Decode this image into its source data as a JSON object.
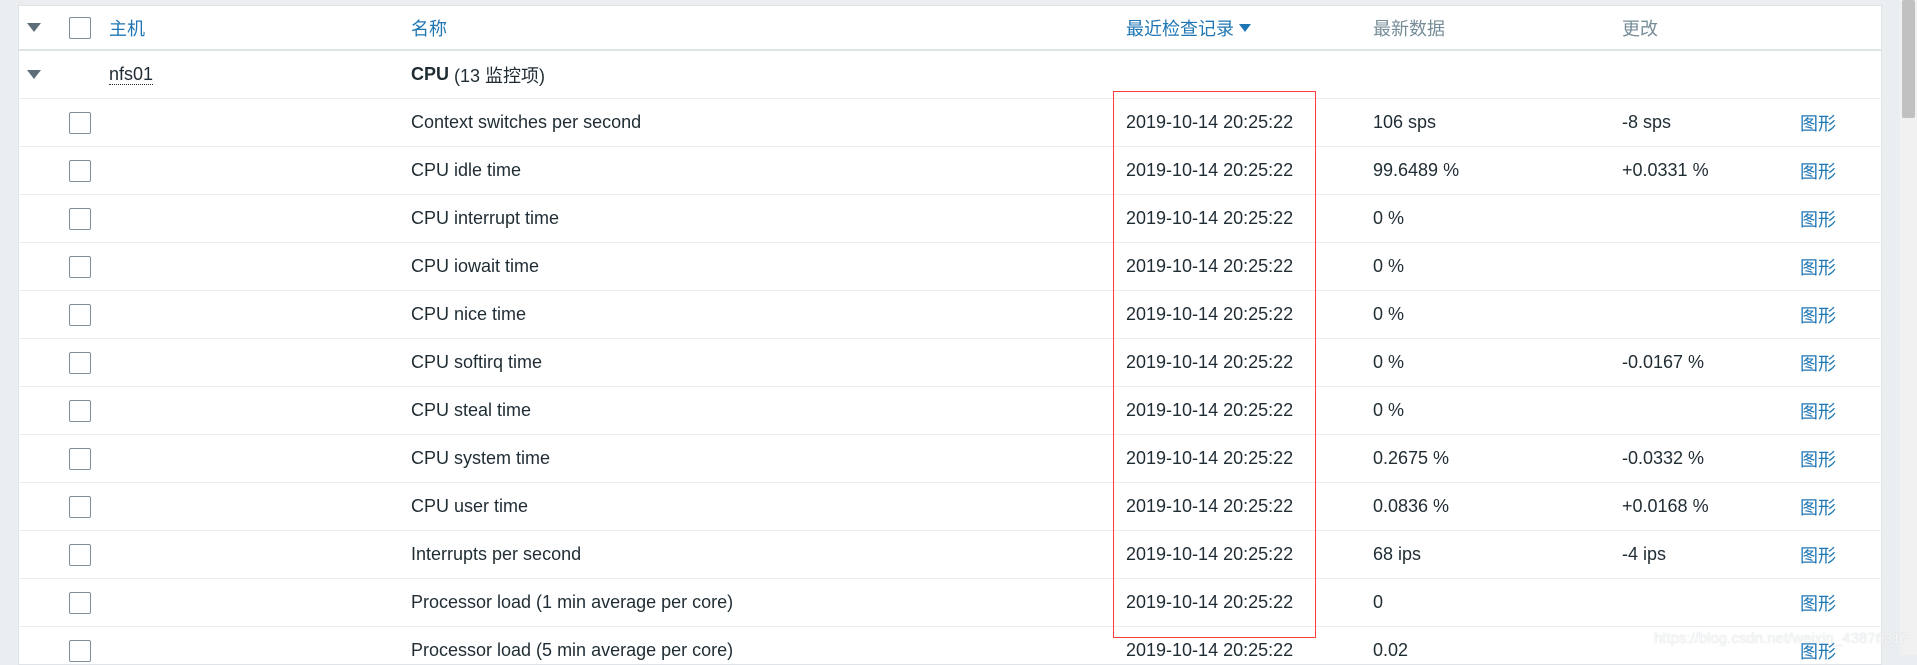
{
  "header": {
    "host_label": "主机",
    "name_label": "名称",
    "lastcheck_label": "最近检查记录",
    "lastvalue_label": "最新数据",
    "change_label": "更改"
  },
  "group": {
    "host": "nfs01",
    "name_bold": "CPU",
    "count_text": " (13 监控项)"
  },
  "items": [
    {
      "name": "Context switches per second",
      "lastcheck": "2019-10-14 20:25:22",
      "lastvalue": "106 sps",
      "change": "-8 sps",
      "action": "图形"
    },
    {
      "name": "CPU idle time",
      "lastcheck": "2019-10-14 20:25:22",
      "lastvalue": "99.6489 %",
      "change": "+0.0331 %",
      "action": "图形"
    },
    {
      "name": "CPU interrupt time",
      "lastcheck": "2019-10-14 20:25:22",
      "lastvalue": "0 %",
      "change": "",
      "action": "图形"
    },
    {
      "name": "CPU iowait time",
      "lastcheck": "2019-10-14 20:25:22",
      "lastvalue": "0 %",
      "change": "",
      "action": "图形"
    },
    {
      "name": "CPU nice time",
      "lastcheck": "2019-10-14 20:25:22",
      "lastvalue": "0 %",
      "change": "",
      "action": "图形"
    },
    {
      "name": "CPU softirq time",
      "lastcheck": "2019-10-14 20:25:22",
      "lastvalue": "0 %",
      "change": "-0.0167 %",
      "action": "图形"
    },
    {
      "name": "CPU steal time",
      "lastcheck": "2019-10-14 20:25:22",
      "lastvalue": "0 %",
      "change": "",
      "action": "图形"
    },
    {
      "name": "CPU system time",
      "lastcheck": "2019-10-14 20:25:22",
      "lastvalue": "0.2675 %",
      "change": "-0.0332 %",
      "action": "图形"
    },
    {
      "name": "CPU user time",
      "lastcheck": "2019-10-14 20:25:22",
      "lastvalue": "0.0836 %",
      "change": "+0.0168 %",
      "action": "图形"
    },
    {
      "name": "Interrupts per second",
      "lastcheck": "2019-10-14 20:25:22",
      "lastvalue": "68 ips",
      "change": "-4 ips",
      "action": "图形"
    },
    {
      "name": "Processor load (1 min average per core)",
      "lastcheck": "2019-10-14 20:25:22",
      "lastvalue": "0",
      "change": "",
      "action": "图形"
    },
    {
      "name": "Processor load (5 min average per core)",
      "lastcheck": "2019-10-14 20:25:22",
      "lastvalue": "0.02",
      "change": "",
      "action": "图形"
    }
  ],
  "watermark": "https://blog.csdn.net/weixin_43876317",
  "colors": {
    "link": "#1f76b5",
    "highlight_box": "#ff3b3b",
    "background": "#ebeef0"
  }
}
